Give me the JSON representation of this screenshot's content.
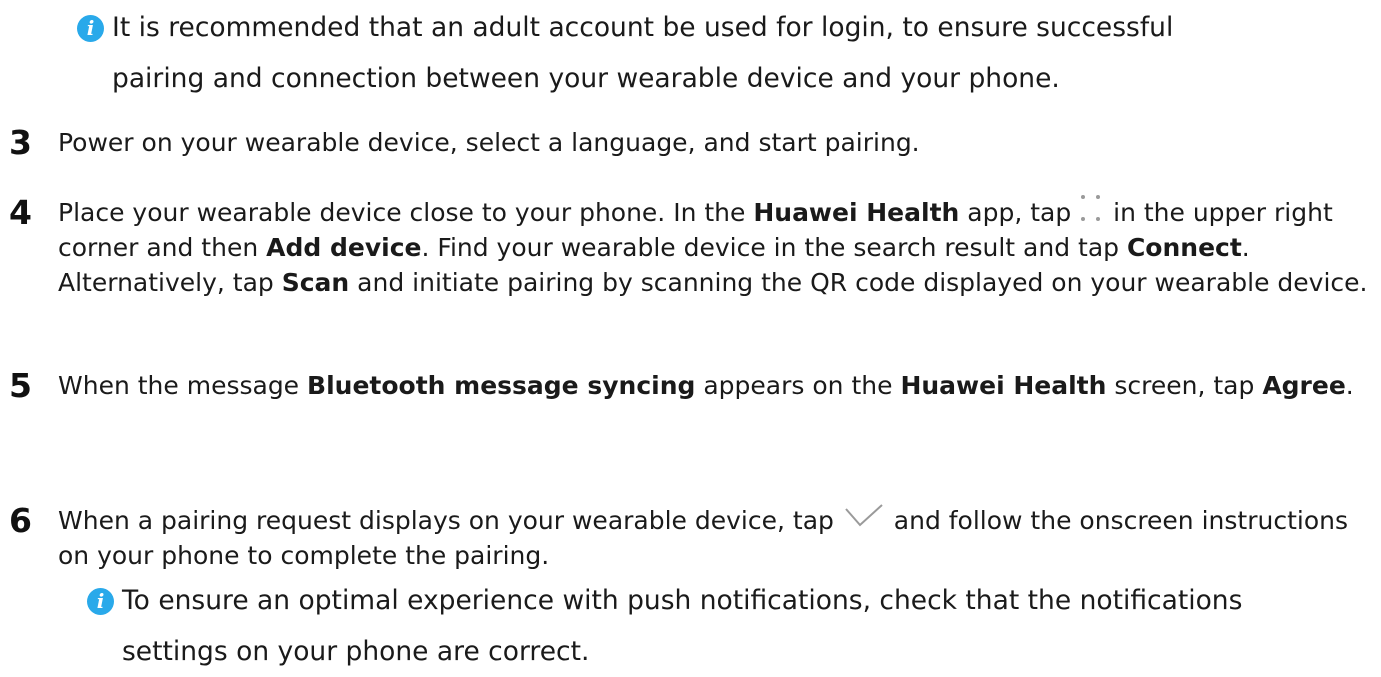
{
  "note1": {
    "icon": "info-icon",
    "line1": "It is recommended that an adult account be used for login, to ensure successful",
    "line2": "pairing and connection between your wearable device and your phone."
  },
  "steps": [
    {
      "number": "3",
      "text": "Power on your wearable device, select a language, and start pairing."
    },
    {
      "number": "4",
      "t1": "Place your wearable device close to your phone. In the ",
      "b1": "Huawei Health",
      "t2": " app, tap ",
      "icon": "more-dots-icon",
      "t3": " in the upper right corner and then ",
      "b2": "Add device",
      "t4": ". Find your wearable device in the search result and tap ",
      "b3": "Connect",
      "t5": ". Alternatively, tap ",
      "b4": "Scan",
      "t6": " and initiate pairing by scanning the QR code displayed on your wearable device."
    },
    {
      "number": "5",
      "t1": "When the message ",
      "b1": "Bluetooth message syncing",
      "t2": " appears on the ",
      "b2": "Huawei Health",
      "t3": " screen, tap ",
      "b3": "Agree",
      "t4": "."
    },
    {
      "number": "6",
      "t1": "When a pairing request displays on your wearable device, tap ",
      "icon": "check-icon",
      "t2": " and follow the onscreen instructions on your phone to complete the pairing."
    }
  ],
  "note2": {
    "icon": "info-icon",
    "line1": "To ensure an optimal experience with push notifications, check that the notifications",
    "line2": "settings on your phone are correct."
  },
  "colors": {
    "info_icon": "#29a9ea",
    "text": "#1a1a1a",
    "icon_gray": "#9a9a9a"
  }
}
